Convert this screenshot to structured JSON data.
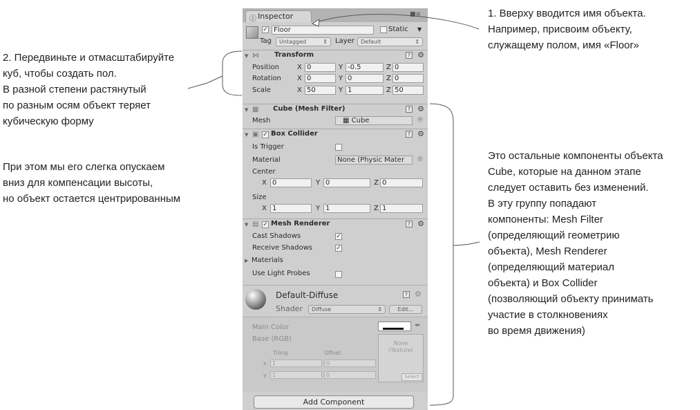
{
  "annotations": {
    "top": [
      "1. Вверху вводится имя объекта.",
      "Например, присвоим объекту,",
      "служащему полом, имя «Floor»"
    ],
    "left1": [
      "2. Передвиньте и отмасштабируйте",
      "куб, чтобы создать пол.",
      "В разной степени растянутый",
      "по разным осям объект теряет",
      "кубическую форму"
    ],
    "left2": [
      "При этом мы его слегка опускаем",
      "вниз для компенсации высоты,",
      "но объект остается центрированным"
    ],
    "right": [
      "Это остальные компоненты объекта",
      "Cube, которые на данном этапе",
      "следует оставить без изменений.",
      "В эту группу попадают",
      "компоненты: Mesh Filter",
      "(определяющий геометрию",
      "объекта), Mesh Renderer",
      "(определяющий материал",
      "объекта) и Box Collider",
      "(позволяющий объекту принимать",
      "участие в столкновениях",
      "во время движения)"
    ]
  },
  "inspector": {
    "tab_label": "Inspector",
    "object": {
      "active": true,
      "name": "Floor",
      "static_label": "Static",
      "static": false,
      "tag_label": "Tag",
      "tag_value": "Untagged",
      "layer_label": "Layer",
      "layer_value": "Default"
    },
    "transform": {
      "title": "Transform",
      "rows": [
        {
          "label": "Position",
          "x": "0",
          "y": "-0.5",
          "z": "0"
        },
        {
          "label": "Rotation",
          "x": "0",
          "y": "0",
          "z": "0"
        },
        {
          "label": "Scale",
          "x": "50",
          "y": "1",
          "z": "50"
        }
      ]
    },
    "mesh_filter": {
      "title": "Cube (Mesh Filter)",
      "mesh_label": "Mesh",
      "mesh_value": "Cube"
    },
    "box_collider": {
      "title": "Box Collider",
      "enabled": true,
      "is_trigger_label": "Is Trigger",
      "is_trigger": false,
      "material_label": "Material",
      "material_value": "None (Physic Mater",
      "center_label": "Center",
      "center": {
        "x": "0",
        "y": "0",
        "z": "0"
      },
      "size_label": "Size",
      "size": {
        "x": "1",
        "y": "1",
        "z": "1"
      }
    },
    "mesh_renderer": {
      "title": "Mesh Renderer",
      "enabled": true,
      "cast_shadows_label": "Cast Shadows",
      "cast_shadows": true,
      "receive_shadows_label": "Receive Shadows",
      "receive_shadows": true,
      "materials_label": "Materials",
      "use_light_probes_label": "Use Light Probes",
      "use_light_probes": false
    },
    "material": {
      "name": "Default-Diffuse",
      "shader_label": "Shader",
      "shader_value": "Diffuse",
      "edit_label": "Edit...",
      "main_color_label": "Main Color",
      "base_label": "Base (RGB)",
      "tiling_label": "Tiling",
      "offset_label": "Offset",
      "x_label": "x",
      "y_label": "y",
      "tiling": {
        "x": "1",
        "y": "1"
      },
      "offset": {
        "x": "0",
        "y": "0"
      },
      "texture_none": "None",
      "texture_type": "(Texture)",
      "select_label": "Select"
    },
    "add_component_label": "Add Component"
  },
  "axis_labels": {
    "x": "X",
    "y": "Y",
    "z": "Z"
  },
  "colors": {
    "panel_bg": "#cfcfcf",
    "field_bg": "#f1f1f1",
    "text": "#222222"
  }
}
